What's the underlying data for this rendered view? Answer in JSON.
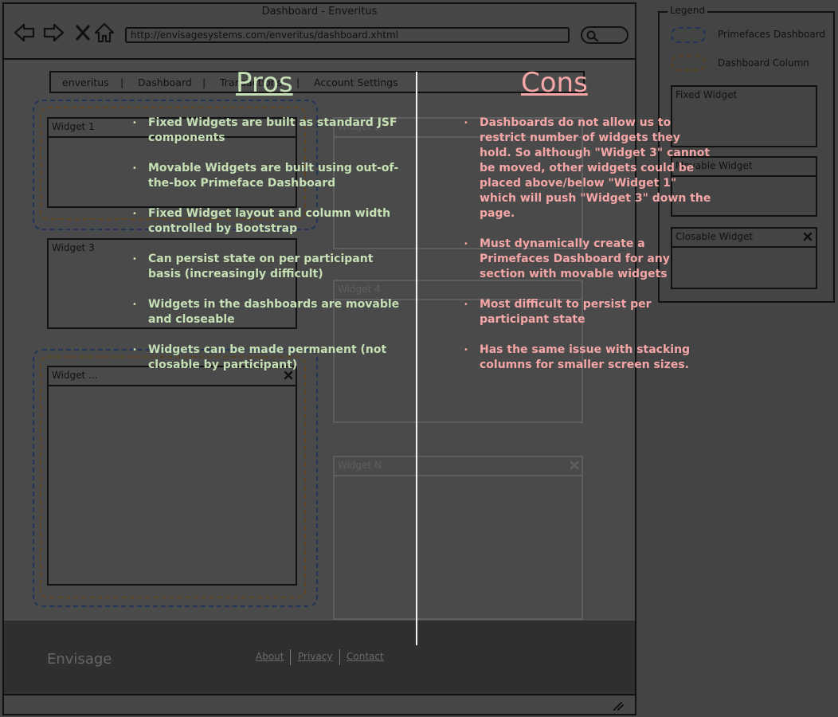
{
  "browser": {
    "title": "Dashboard - Enveritus",
    "url": "http://envisagesystems.com/enveritus/dashboard.xhtml"
  },
  "menu": {
    "items": [
      "enveritus",
      "|",
      "Dashboard",
      "|",
      "Transactions",
      "|",
      "Account Settings"
    ]
  },
  "widgets": {
    "w1": "Widget 1",
    "w2": "Widget 2",
    "w3": "Widget 3",
    "w4": "Widget 4",
    "wdots": "Widget ...",
    "wn": "Widget N"
  },
  "footer": {
    "brand": "Envisage",
    "links": [
      "About",
      "Privacy",
      "Contact"
    ]
  },
  "legend": {
    "title": "Legend",
    "primefaces": "Primefaces Dashboard",
    "column": "Dashboard Column",
    "fixed": "Fixed Widget",
    "movable": "Movable Widget",
    "closable": "Closable Widget"
  },
  "pros": {
    "heading": "Pros",
    "items": [
      "Fixed Widgets are built as standard JSF components",
      "Movable Widgets are built using out-of-the-box Primeface Dashboard",
      "Fixed Widget layout and column width controlled by Bootstrap",
      "Can persist state on per participant basis (increasingly difficult)",
      "Widgets in the dashboards are movable and closeable",
      "Widgets can be made permanent (not closable by participant)"
    ]
  },
  "cons": {
    "heading": "Cons",
    "items": [
      "Dashboards do not allow us to restrict number of widgets they hold.  So although \"Widget 3\" cannot be moved, other widgets could be placed above/below \"Widget 1\" which will push \"Widget 3\" down the page.",
      "Must dynamically create a Primefaces Dashboard for any section with movable widgets",
      "Most difficult to persist per participant state",
      "Has the same issue with stacking columns for smaller screen sizes."
    ]
  },
  "colors": {
    "pros": "#c5e0b4",
    "cons": "#f4a6a6",
    "primefaces_outline": "#23345a",
    "column_outline": "#5c4422"
  }
}
